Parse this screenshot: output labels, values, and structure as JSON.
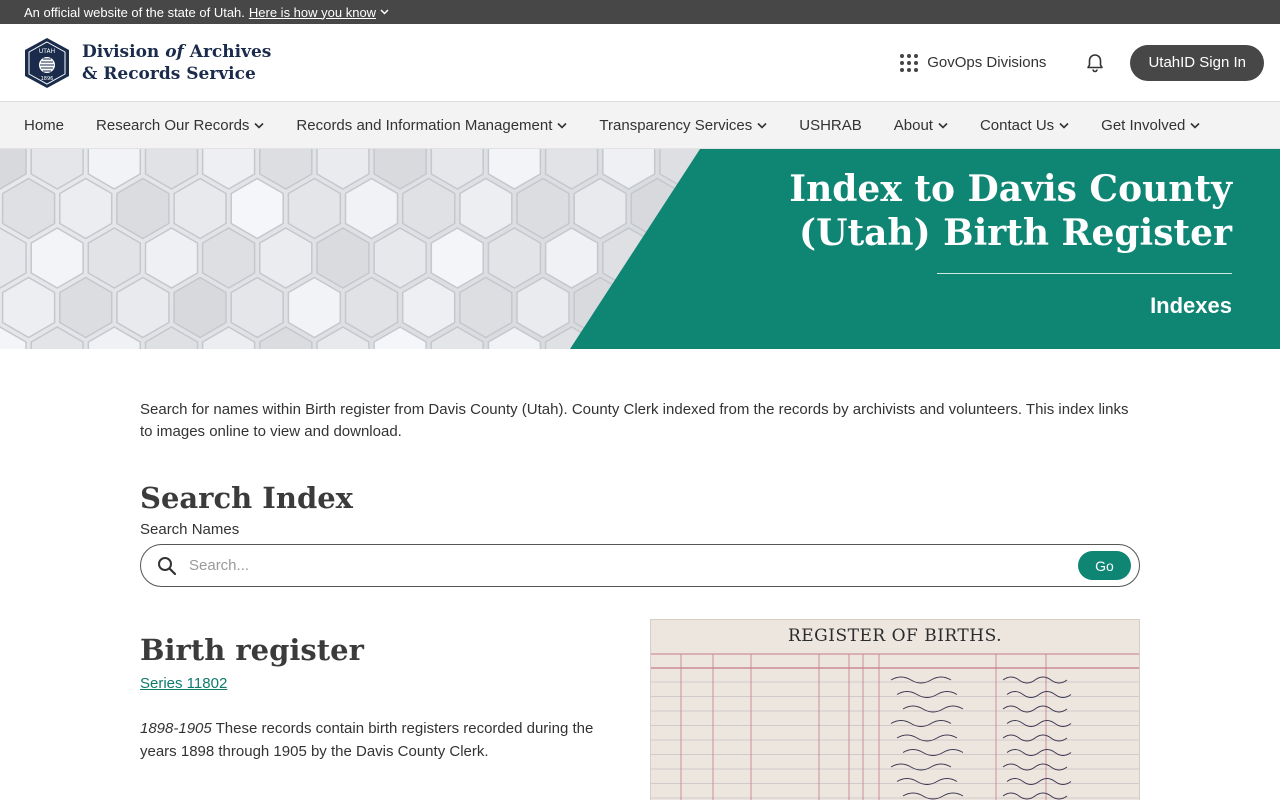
{
  "gov_banner": {
    "text": "An official website of the state of Utah.",
    "link": "Here is how you know"
  },
  "header": {
    "logo_line1": "Division",
    "logo_of": "of",
    "logo_archives": "Archives",
    "logo_line2": "& Records Service",
    "govops_label": "GovOps Divisions",
    "signin_label": "UtahID Sign In"
  },
  "nav": {
    "items": [
      {
        "label": "Home",
        "dropdown": false
      },
      {
        "label": "Research Our Records",
        "dropdown": true
      },
      {
        "label": "Records and Information Management",
        "dropdown": true
      },
      {
        "label": "Transparency Services",
        "dropdown": true
      },
      {
        "label": "USHRAB",
        "dropdown": false
      },
      {
        "label": "About",
        "dropdown": true
      },
      {
        "label": "Contact Us",
        "dropdown": true
      },
      {
        "label": "Get Involved",
        "dropdown": true
      }
    ]
  },
  "hero": {
    "title_line1": "Index to Davis County",
    "title_line2": "(Utah) Birth Register",
    "subtitle": "Indexes",
    "accent_color": "#0f8574"
  },
  "main": {
    "intro": "Search for names within Birth register from Davis County (Utah). County Clerk indexed from the records by archivists and volunteers. This index links to images online to view and download.",
    "search_heading": "Search Index",
    "search_label": "Search Names",
    "search_placeholder": "Search...",
    "go_label": "Go",
    "record_heading": "Birth register",
    "series_link": "Series 11802",
    "date_range": "1898-1905",
    "description": " These records contain birth registers recorded during the years 1898 through 1905 by the Davis County Clerk.",
    "image_title": "REGISTER OF BIRTHS."
  },
  "icons": {
    "seal": "utah-seal-icon",
    "grid": "grid-dots-icon",
    "bell": "bell-icon",
    "search": "search-icon",
    "chevron": "chevron-down-icon"
  }
}
